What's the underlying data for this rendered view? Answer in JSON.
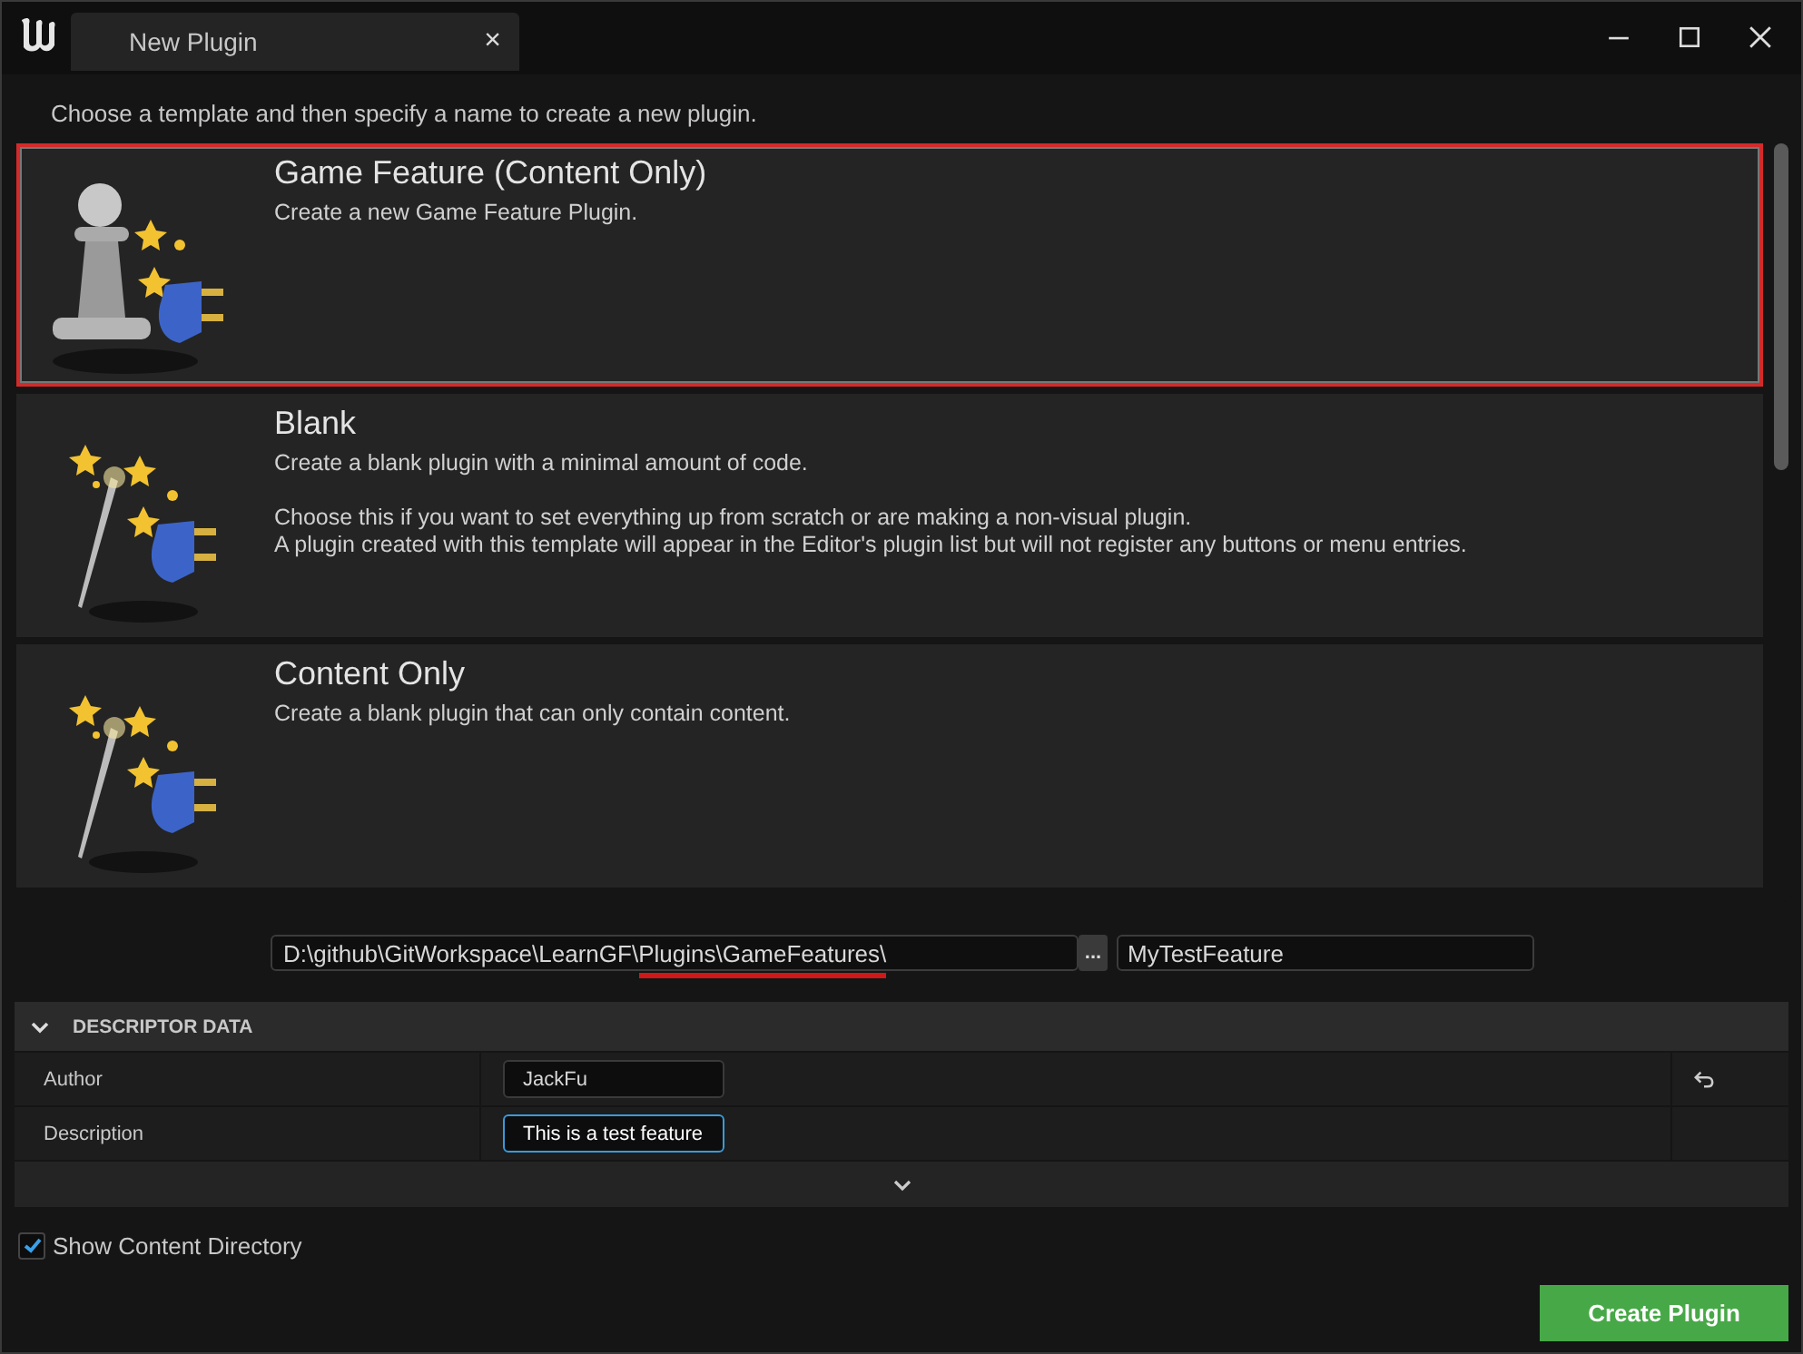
{
  "window": {
    "title": "New Plugin",
    "close": "×"
  },
  "instruction": "Choose a template and then specify a name to create a new plugin.",
  "templates": [
    {
      "title": "Game Feature (Content Only)",
      "kind": "feature",
      "selected": true,
      "paragraphs": [
        [
          "Create a new Game Feature Plugin."
        ]
      ]
    },
    {
      "title": "Blank",
      "kind": "plugin",
      "selected": false,
      "paragraphs": [
        [
          "Create a blank plugin with a minimal amount of code."
        ],
        [
          "Choose this if you want to set everything up from scratch or are making a non-visual plugin.",
          "A plugin created with this template will appear in the Editor's plugin list but will not register any buttons or menu entries."
        ]
      ]
    },
    {
      "title": "Content Only",
      "kind": "plugin",
      "selected": false,
      "paragraphs": [
        [
          "Create a blank plugin that can only contain content."
        ]
      ]
    }
  ],
  "path": {
    "start": "D:\\github\\GitWorkspace\\LearnGF\\",
    "marked": "Plugins\\GameFeatures\\",
    "browse": "..."
  },
  "plugin_name": {
    "value": "MyTestFeature"
  },
  "descriptor": {
    "title": "DESCRIPTOR DATA",
    "expanded": true,
    "rows": [
      {
        "label": "Author",
        "value": "JackFu",
        "focused": false,
        "reset": true
      },
      {
        "label": "Description",
        "value": "This is a test feature",
        "focused": true,
        "reset": false
      }
    ]
  },
  "show_content_directory": {
    "label": "Show Content Directory",
    "checked": true
  },
  "create_button": "Create Plugin"
}
